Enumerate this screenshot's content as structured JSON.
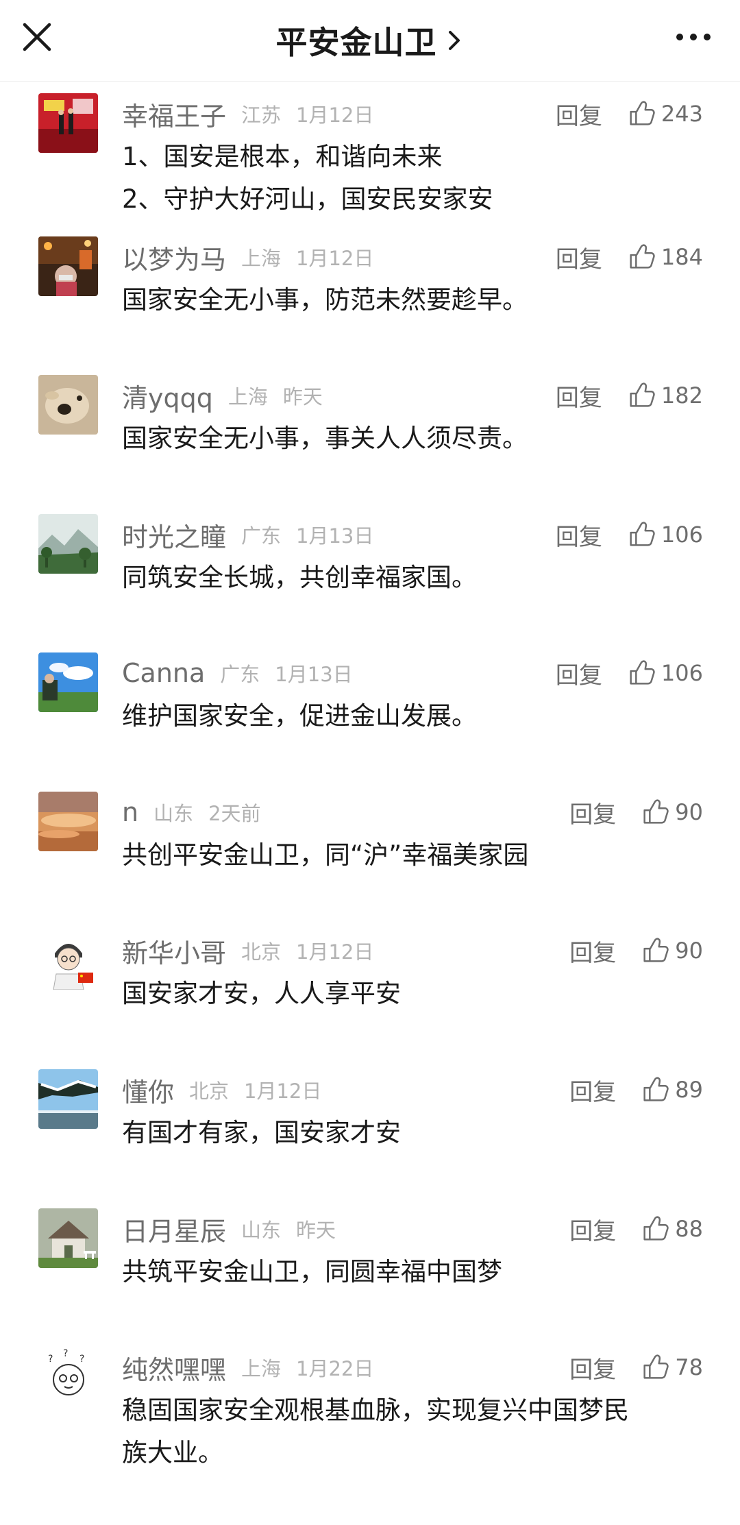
{
  "header": {
    "title": "平安金山卫"
  },
  "comments": [
    {
      "name": "幸福王子",
      "location": "江苏",
      "date": "1月12日",
      "reply": "回复",
      "likes": "243",
      "lines": [
        "1、国安是根本，和谐向未来",
        "2、守护大好河山，国安民安家安"
      ],
      "avatar": "avatar-event-stage"
    },
    {
      "name": "以梦为马",
      "location": "上海",
      "date": "1月12日",
      "reply": "回复",
      "likes": "184",
      "lines": [
        "国家安全无小事，防范未然要趁早。"
      ],
      "avatar": "avatar-night-street-portrait"
    },
    {
      "name": "清yqqq",
      "location": "上海",
      "date": "昨天",
      "reply": "回复",
      "likes": "182",
      "lines": [
        "国家安全无小事，事关人人须尽责。"
      ],
      "avatar": "avatar-dog"
    },
    {
      "name": "时光之瞳",
      "location": "广东",
      "date": "1月13日",
      "reply": "回复",
      "likes": "106",
      "lines": [
        "同筑安全长城，共创幸福家国。"
      ],
      "avatar": "avatar-mountain-landscape"
    },
    {
      "name": "Canna",
      "location": "广东",
      "date": "1月13日",
      "reply": "回复",
      "likes": "106",
      "lines": [
        "维护国家安全，促进金山发展。"
      ],
      "avatar": "avatar-blue-sky"
    },
    {
      "name": "n",
      "location": "山东",
      "date": "2天前",
      "reply": "回复",
      "likes": "90",
      "lines": [
        "共创平安金山卫，同“沪”幸福美家园"
      ],
      "avatar": "avatar-sunset-sky"
    },
    {
      "name": "新华小哥",
      "location": "北京",
      "date": "1月12日",
      "reply": "回复",
      "likes": "90",
      "lines": [
        "国安家才安，人人享平安"
      ],
      "avatar": "avatar-cartoon-boy"
    },
    {
      "name": "懂你",
      "location": "北京",
      "date": "1月12日",
      "reply": "回复",
      "likes": "89",
      "lines": [
        "有国才有家，国安家才安"
      ],
      "avatar": "avatar-snowy-pine"
    },
    {
      "name": "日月星辰",
      "location": "山东",
      "date": "昨天",
      "reply": "回复",
      "likes": "88",
      "lines": [
        "共筑平安金山卫，同圆幸福中国梦"
      ],
      "avatar": "avatar-cottage"
    },
    {
      "name": "纯然嘿嘿",
      "location": "上海",
      "date": "1月22日",
      "reply": "回复",
      "likes": "78",
      "lines": [
        "稳固国家安全观根基血脉，实现复兴中国梦民",
        "族大业。"
      ],
      "avatar": "avatar-cartoon-sketch"
    }
  ]
}
